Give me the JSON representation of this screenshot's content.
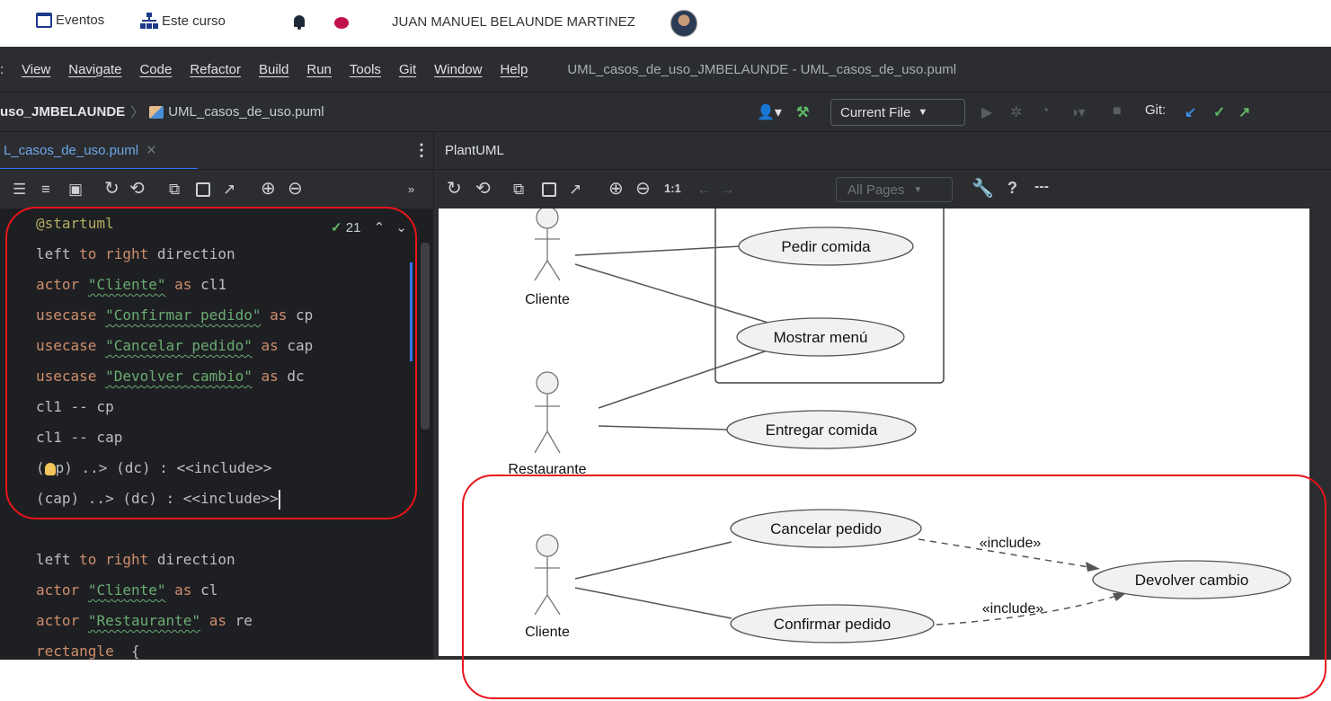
{
  "webbar": {
    "events_label": "Eventos",
    "course_label": "Este curso",
    "user_name": "JUAN MANUEL BELAUNDE MARTINEZ"
  },
  "menu": {
    "items": [
      "View",
      "Navigate",
      "Code",
      "Refactor",
      "Build",
      "Run",
      "Tools",
      "Git",
      "Window",
      "Help"
    ],
    "window_title": "UML_casos_de_uso_JMBELAUNDE - UML_casos_de_uso.puml"
  },
  "navbar": {
    "project": "uso_JMBELAUNDE",
    "file": "UML_casos_de_uso.puml",
    "run_config": "Current File",
    "git_label": "Git:"
  },
  "editor": {
    "tab_label": "L_casos_de_uso.puml",
    "inspection_count": "21",
    "lines": [
      "@startuml",
      "left to right direction",
      "actor \"Cliente\" as cl1",
      "usecase \"Confirmar pedido\" as cp",
      "usecase \"Cancelar pedido\" as cap",
      "usecase \"Devolver cambio\" as dc",
      "cl1 -- cp",
      "cl1 -- cap",
      "(cp) ..> (dc) : <<include>>",
      "(cap) ..> (dc) : <<include>>",
      "",
      "left to right direction",
      "actor \"Cliente\" as cl",
      "actor \"Restaurante\" as re",
      "rectangle  {"
    ]
  },
  "preview": {
    "tab_label": "PlantUML",
    "zoom_label": "1:1",
    "pages_label": "All Pages",
    "help_label": "?",
    "more_label": "---"
  },
  "diagram": {
    "actors": {
      "cliente_top": "Cliente",
      "restaurante": "Restaurante",
      "cliente_bottom": "Cliente"
    },
    "usecases": {
      "pedir": "Pedir comida",
      "mostrar": "Mostrar menú",
      "entregar": "Entregar comida",
      "cancelar": "Cancelar pedido",
      "confirmar": "Confirmar pedido",
      "devolver": "Devolver cambio"
    },
    "include_top": "«include»",
    "include_bottom": "«include»"
  },
  "colors": {
    "ide_bg": "#2b2d30",
    "editor_bg": "#1e1f22",
    "keyword": "#cf8e6d",
    "string": "#6aab73",
    "accent": "#3574f0",
    "highlight": "#e8151b",
    "usecase_fill": "#f1f1f1"
  }
}
